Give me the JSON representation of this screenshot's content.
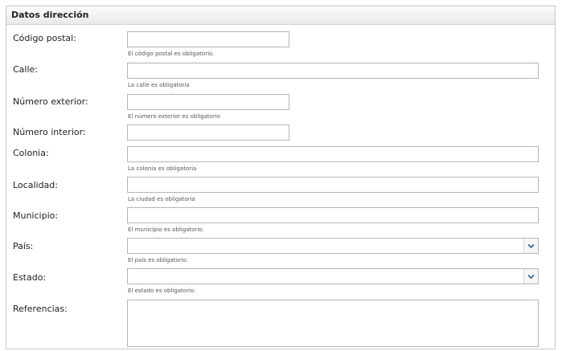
{
  "section": {
    "title": "Datos dirección"
  },
  "fields": {
    "codigo_postal": {
      "label": "Código postal:",
      "value": "",
      "hint": "El código postal es obligatorio."
    },
    "calle": {
      "label": "Calle:",
      "value": "",
      "hint": "La calle es obligatoria"
    },
    "numero_exterior": {
      "label": "Número exterior:",
      "value": "",
      "hint": "El número exterior es obligatorio"
    },
    "numero_interior": {
      "label": "Número interior:",
      "value": ""
    },
    "colonia": {
      "label": "Colonia:",
      "value": "",
      "hint": "La colonia es obligatoria"
    },
    "localidad": {
      "label": "Localidad:",
      "value": "",
      "hint": "La ciudad es obligatoria"
    },
    "municipio": {
      "label": "Municipio:",
      "value": "",
      "hint": "El municipio es obligatorio."
    },
    "pais": {
      "label": "País:",
      "selected": "",
      "hint": "El país es obligatorio."
    },
    "estado": {
      "label": "Estado:",
      "selected": "",
      "hint": "El estado es obligatorio."
    },
    "referencias": {
      "label": "Referencias:",
      "value": ""
    }
  },
  "icons": {
    "dropdown": "chevron-down-icon"
  },
  "colors": {
    "border": "#aeb6c0",
    "chevron": "#3d6aa5",
    "header_bg": "#efefef"
  }
}
